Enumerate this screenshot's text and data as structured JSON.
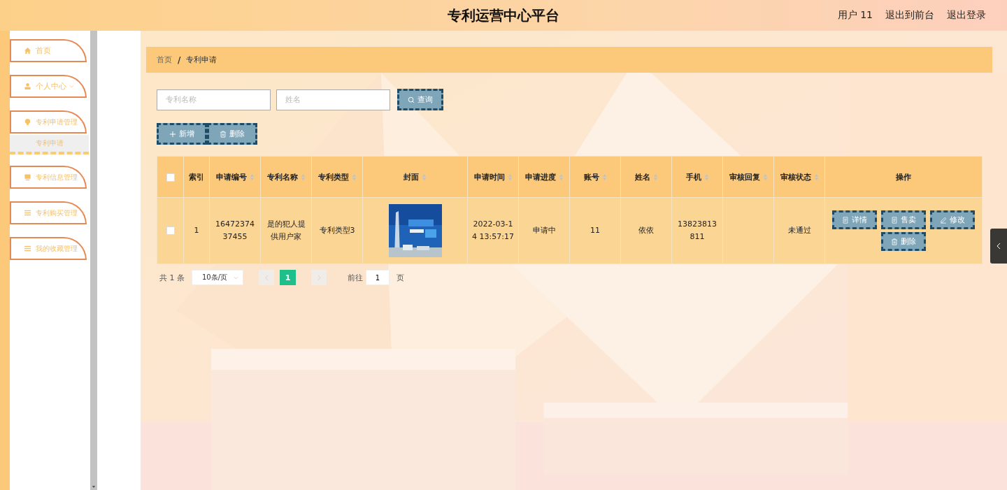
{
  "header": {
    "title": "专利运营中心平台",
    "user": "用户 11",
    "links": [
      "退出到前台",
      "退出登录"
    ]
  },
  "sidebar": {
    "items": [
      {
        "label": "首页",
        "kind": "link"
      },
      {
        "label": "个人中心",
        "kind": "menu",
        "expanded": false
      },
      {
        "label": "专利申请管理",
        "kind": "menu",
        "expanded": true,
        "children": [
          {
            "label": "专利申请",
            "selected": true
          }
        ]
      },
      {
        "label": "专利信息管理",
        "kind": "menu",
        "expanded": false
      },
      {
        "label": "专利购买管理",
        "kind": "menu",
        "expanded": false
      },
      {
        "label": "我的收藏管理",
        "kind": "menu",
        "expanded": false
      }
    ]
  },
  "breadcrumb": {
    "items": [
      "首页",
      "专利申请"
    ],
    "separator": "/"
  },
  "search": {
    "fields": [
      {
        "placeholder": "专利名称"
      },
      {
        "placeholder": "姓名"
      }
    ],
    "button": "查询"
  },
  "actions": [
    {
      "label": "新增",
      "kind": "add"
    },
    {
      "label": "删除",
      "kind": "delete"
    }
  ],
  "table": {
    "header_checked": false,
    "columns": [
      {
        "label": "索引",
        "sortable": false
      },
      {
        "label": "申请编号",
        "sortable": true
      },
      {
        "label": "专利名称",
        "sortable": true
      },
      {
        "label": "专利类型",
        "sortable": true
      },
      {
        "label": "封面",
        "sortable": true
      },
      {
        "label": "申请时间",
        "sortable": true
      },
      {
        "label": "申请进度",
        "sortable": true
      },
      {
        "label": "账号",
        "sortable": true
      },
      {
        "label": "姓名",
        "sortable": true
      },
      {
        "label": "手机",
        "sortable": true
      },
      {
        "label": "审核回复",
        "sortable": true
      },
      {
        "label": "审核状态",
        "sortable": true
      },
      {
        "label": "操作",
        "sortable": false
      }
    ],
    "rows": [
      {
        "checked": false,
        "index": "1",
        "application_no": "1647237437455",
        "patent_name": "是的犯人提供用户家",
        "patent_type": "专利类型3",
        "time": "2022-03-14 13:57:17",
        "progress": "申请中",
        "account": "11",
        "name": "依依",
        "phone": "13823813811",
        "status": "未通过",
        "buttons": [
          {
            "label": "详情",
            "kind": "detail"
          },
          {
            "label": "售卖",
            "kind": "sell"
          },
          {
            "label": "修改",
            "kind": "edit"
          },
          {
            "label": "删除",
            "kind": "delete"
          }
        ]
      }
    ]
  },
  "pagination": {
    "total": "共 1 条",
    "page_size": "10条/页",
    "prev_disabled": true,
    "next_disabled": true,
    "pages": [
      {
        "label": "1",
        "selected": true
      }
    ],
    "goto_label": "前往",
    "goto_value": "1",
    "page_unit": "页"
  }
}
